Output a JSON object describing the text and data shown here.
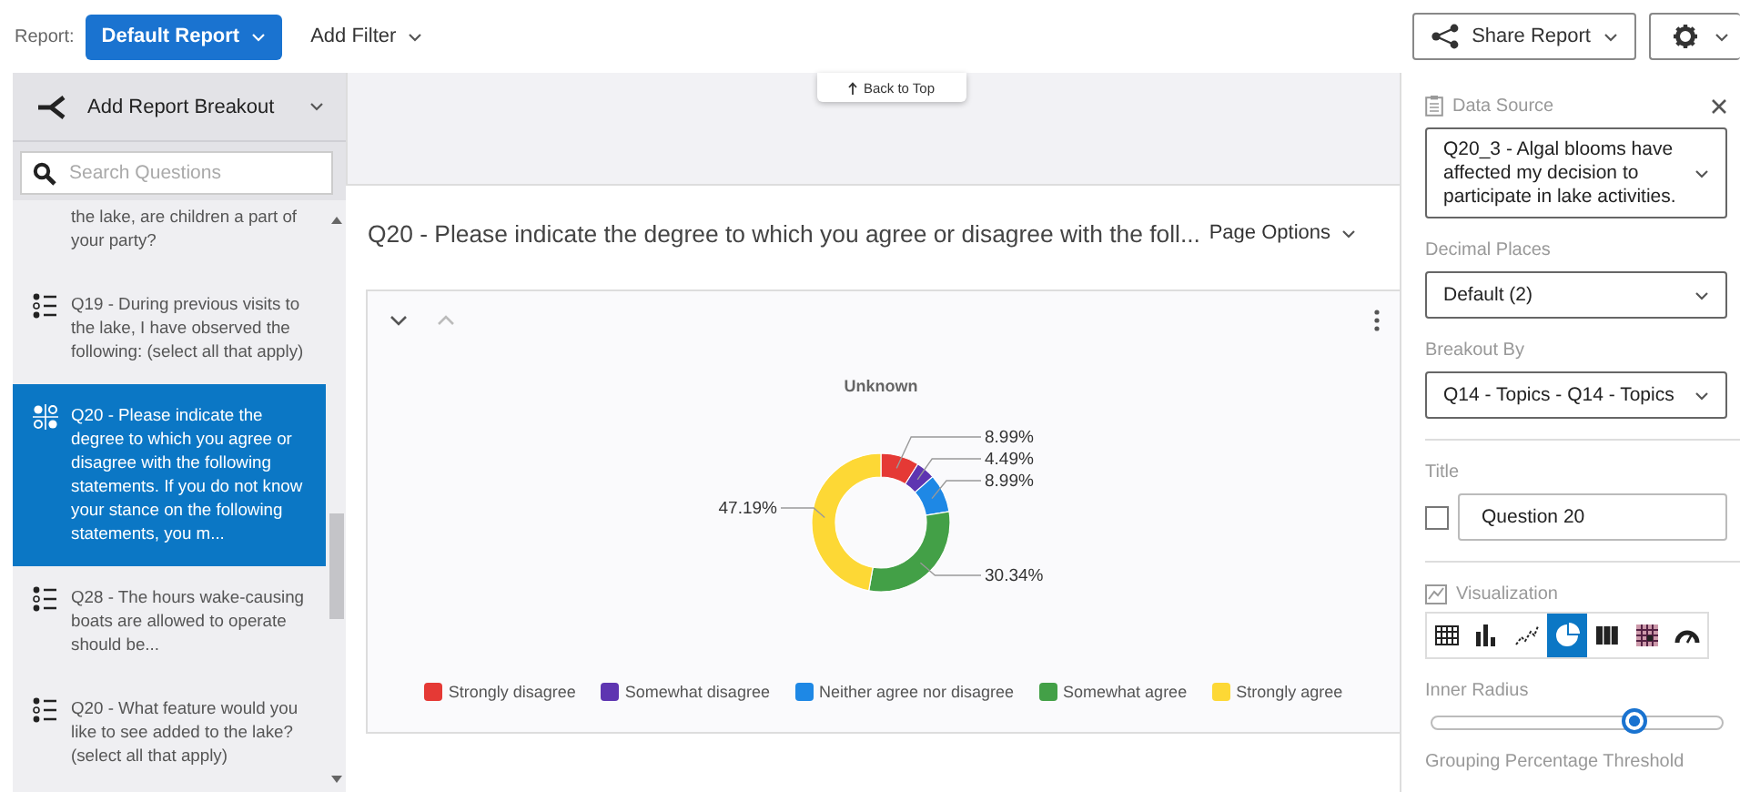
{
  "top_bar": {
    "report_label": "Report:",
    "report_button": "Default Report",
    "add_filter": "Add Filter",
    "share_button": "Share Report"
  },
  "sidebar": {
    "breakout": "Add Report Breakout",
    "search_placeholder": "Search Questions",
    "questions": [
      {
        "kind": "cut",
        "text": "the lake, are children a part of your party?",
        "selected": false
      },
      {
        "kind": "list",
        "text": "Q19 - During previous visits to the lake, I have observed the following: (select all that apply)",
        "selected": false
      },
      {
        "kind": "matrix",
        "text": "Q20 - Please indicate the degree to which you agree or disagree with the following statements. If you do not know your stance on the following statements, you m...",
        "selected": true
      },
      {
        "kind": "list",
        "text": "Q28 - The hours wake-causing boats are allowed to operate should be...",
        "selected": false
      },
      {
        "kind": "list",
        "text": "Q20 - What feature would you like to see added to the lake? (select all that apply)",
        "selected": false
      }
    ]
  },
  "back_to_top": "Back to Top",
  "page": {
    "title": "Q20 - Please indicate the degree to which you agree or disagree with the foll...",
    "page_options": "Page Options"
  },
  "chart_card": {
    "chart_data": {
      "type": "donut",
      "title": "Unknown",
      "categories": [
        "Strongly disagree",
        "Somewhat disagree",
        "Neither agree nor disagree",
        "Somewhat agree",
        "Strongly agree"
      ],
      "values": [
        8.99,
        4.49,
        8.99,
        30.34,
        47.19
      ],
      "colors": [
        "#e53935",
        "#5e35b1",
        "#1e88e5",
        "#43a047",
        "#fdd835"
      ],
      "value_labels": [
        "8.99%",
        "4.49%",
        "8.99%",
        "30.34%",
        "47.19%"
      ]
    }
  },
  "settings": {
    "data_source_label": "Data Source",
    "data_source": "Q20_3 - Algal blooms have affected my decision to participate in lake activities.",
    "decimal_label": "Decimal Places",
    "decimal": "Default (2)",
    "breakout_label": "Breakout By",
    "breakout": "Q14 - Topics - Q14 - Topics",
    "title_label": "Title",
    "title_checked": false,
    "title_value": "Question 20",
    "visualization_label": "Visualization",
    "visualizations": [
      {
        "kind": "table",
        "selected": false
      },
      {
        "kind": "bar",
        "selected": false
      },
      {
        "kind": "line",
        "selected": false
      },
      {
        "kind": "pie",
        "selected": true
      },
      {
        "kind": "stacked",
        "selected": false
      },
      {
        "kind": "heatmap",
        "selected": false
      },
      {
        "kind": "gauge",
        "selected": false
      }
    ],
    "inner_radius_label": "Inner Radius",
    "inner_radius": {
      "level": 0.7
    },
    "grouping_label": "Grouping Percentage Threshold"
  }
}
